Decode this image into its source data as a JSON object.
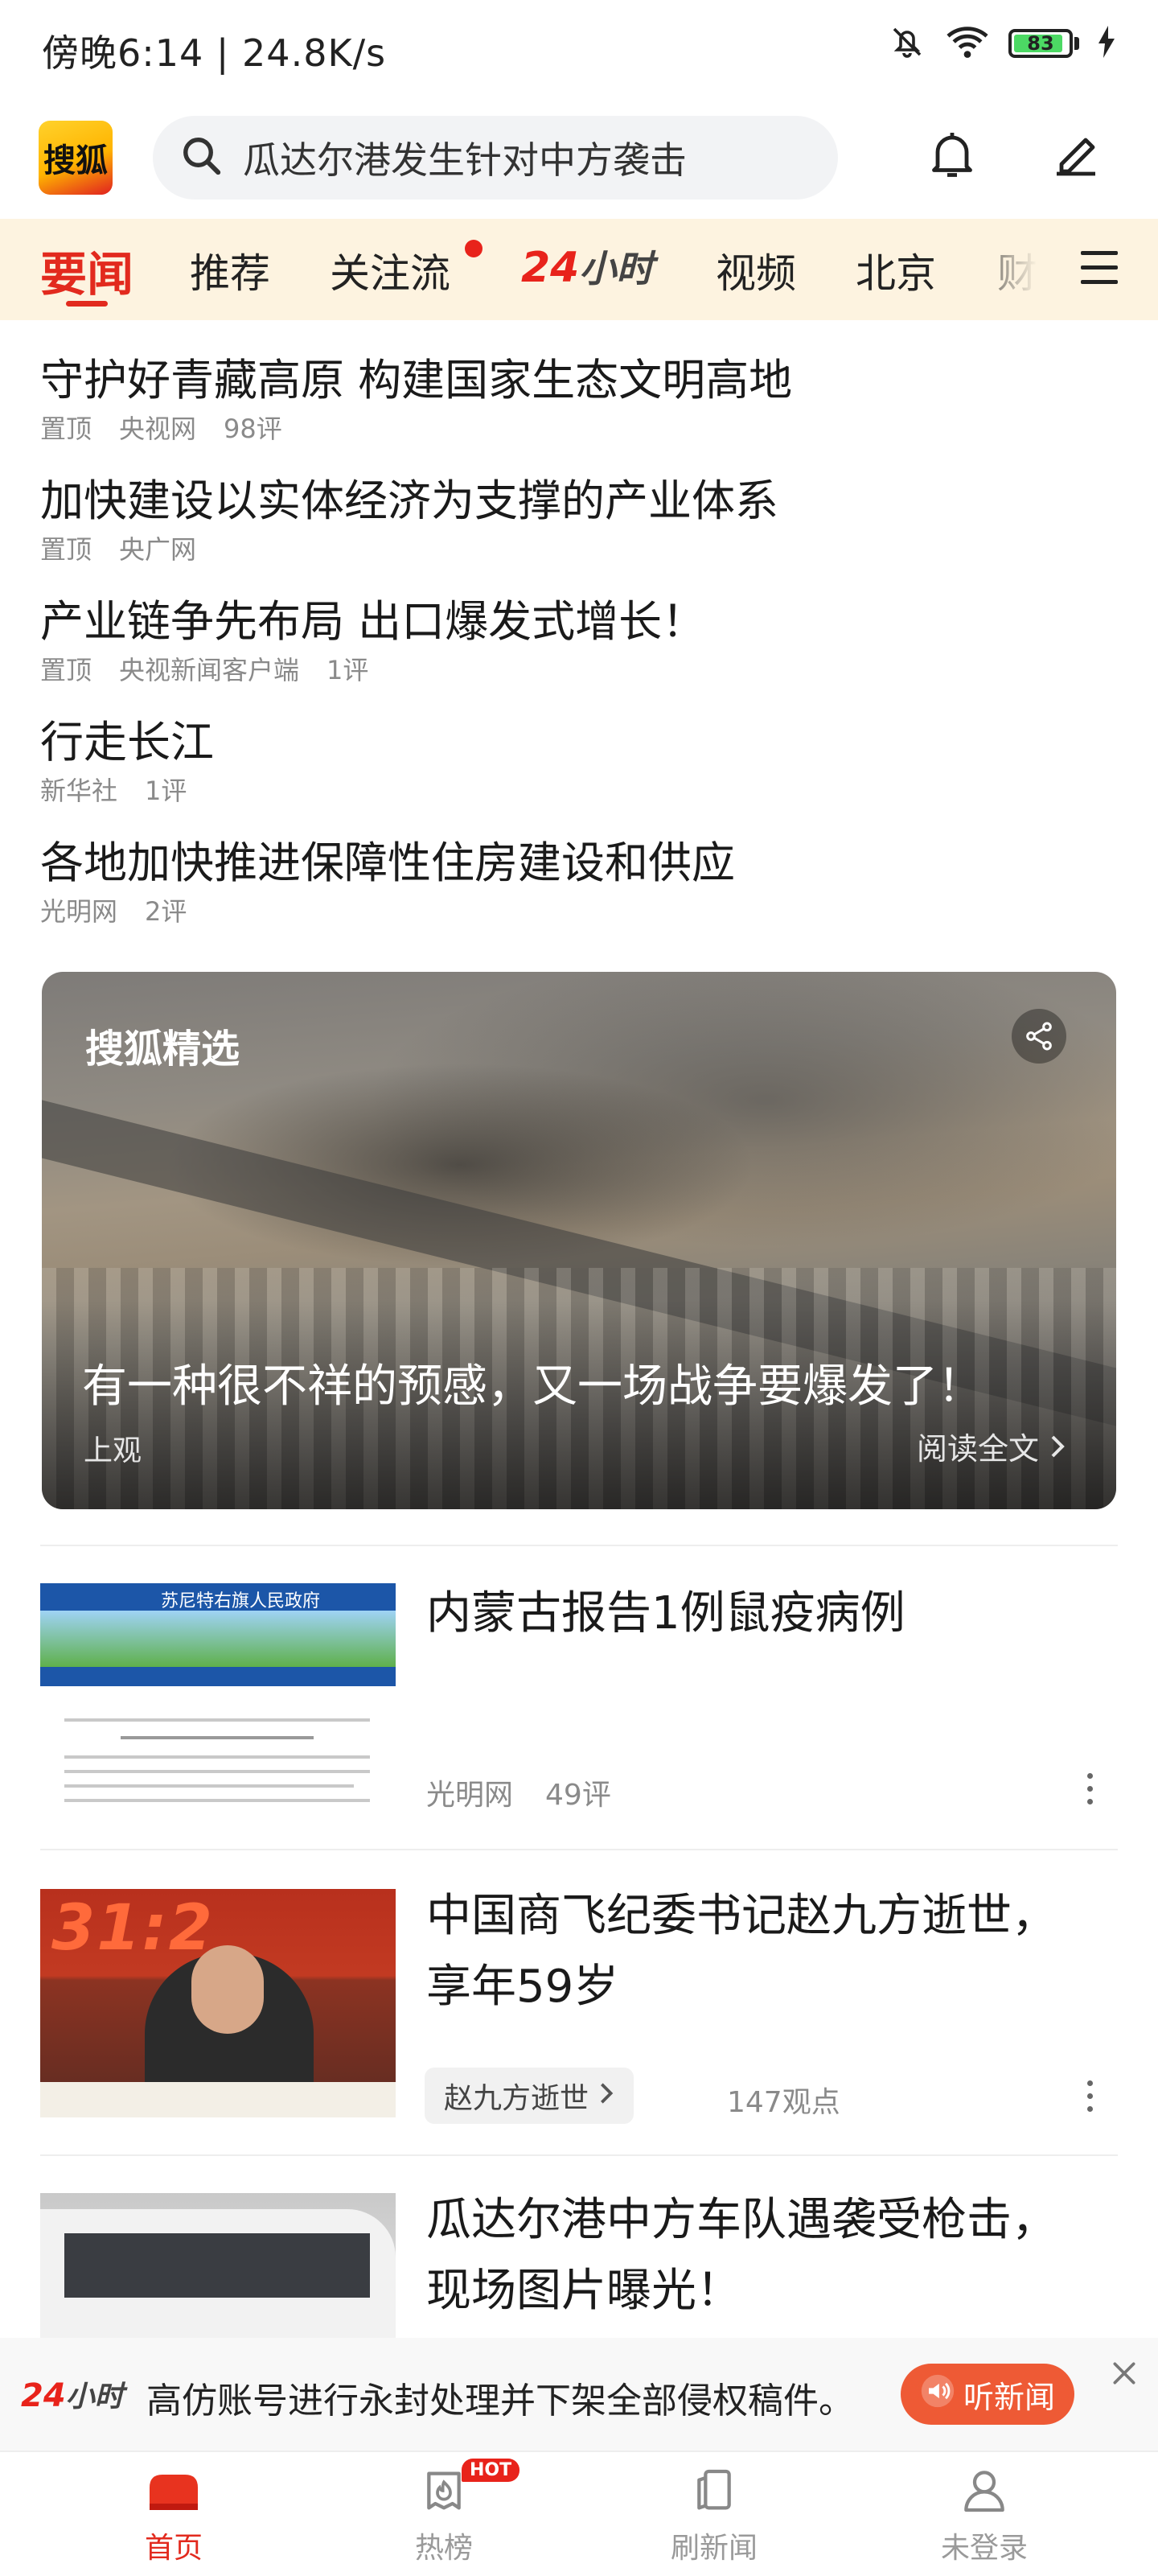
{
  "status_bar": {
    "time_speed": "傍晚6:14 | 24.8K/s",
    "battery_level": "83"
  },
  "header": {
    "logo_text": "搜狐",
    "search_text": "瓜达尔港发生针对中方袭击"
  },
  "tabs": [
    {
      "label": "要闻",
      "active": true
    },
    {
      "label": "推荐"
    },
    {
      "label": "关注流",
      "has_dot": true
    },
    {
      "label_num": "24",
      "label_hours": "小时"
    },
    {
      "label": "视频"
    },
    {
      "label": "北京"
    },
    {
      "label": "财经"
    }
  ],
  "headlines": [
    {
      "title": "守护好青藏高原 构建国家生态文明高地",
      "meta": [
        "置顶",
        "央视网",
        "98评"
      ]
    },
    {
      "title": "加快建设以实体经济为支撑的产业体系",
      "meta": [
        "置顶",
        "央广网"
      ]
    },
    {
      "title": "产业链争先布局 出口爆发式增长！",
      "meta": [
        "置顶",
        "央视新闻客户端",
        "1评"
      ]
    },
    {
      "title": "行走长江",
      "meta": [
        "新华社",
        "1评"
      ]
    },
    {
      "title": "各地加快推进保障性住房建设和供应",
      "meta": [
        "光明网",
        "2评"
      ]
    }
  ],
  "featured": {
    "brand": "搜狐精选",
    "title": "有一种很不祥的预感，又一场战争要爆发了！",
    "source": "上观",
    "read_full": "阅读全文"
  },
  "news_items": [
    {
      "title_line1": "内蒙古报告1例鼠疫病例",
      "title_line2": "",
      "source": "光明网",
      "comments": "49评",
      "thumb_header": "苏尼特右旗人民政府"
    },
    {
      "title_line1": "中国商飞纪委书记赵九方逝世，",
      "title_line2": "享年59岁",
      "topic": "赵九方逝世",
      "views": "147观点",
      "thumb_clock": "31:2"
    },
    {
      "title_line1": "瓜达尔港中方车队遇袭受枪击，",
      "title_line2": "现场图片曝光！"
    }
  ],
  "banner": {
    "logo_num": "24",
    "logo_hours": "小时",
    "text": "高仿账号进行永封处理并下架全部侵权稿件。",
    "listen_label": "听新闻"
  },
  "bottom_nav": [
    {
      "label": "首页",
      "active": true
    },
    {
      "label": "热榜",
      "badge": "HOT"
    },
    {
      "label": "刷新闻"
    },
    {
      "label": "未登录"
    }
  ],
  "colors": {
    "accent": "#e22a1e",
    "tab_bg": "#fdf3e0",
    "listen_btn": "#ee5a35"
  },
  "icons": [
    "bell-icon",
    "edit-icon",
    "search-icon",
    "menu-icon",
    "share-icon",
    "speaker-icon",
    "close-icon",
    "home-icon",
    "hot-list-icon",
    "refresh-news-icon",
    "user-icon"
  ]
}
